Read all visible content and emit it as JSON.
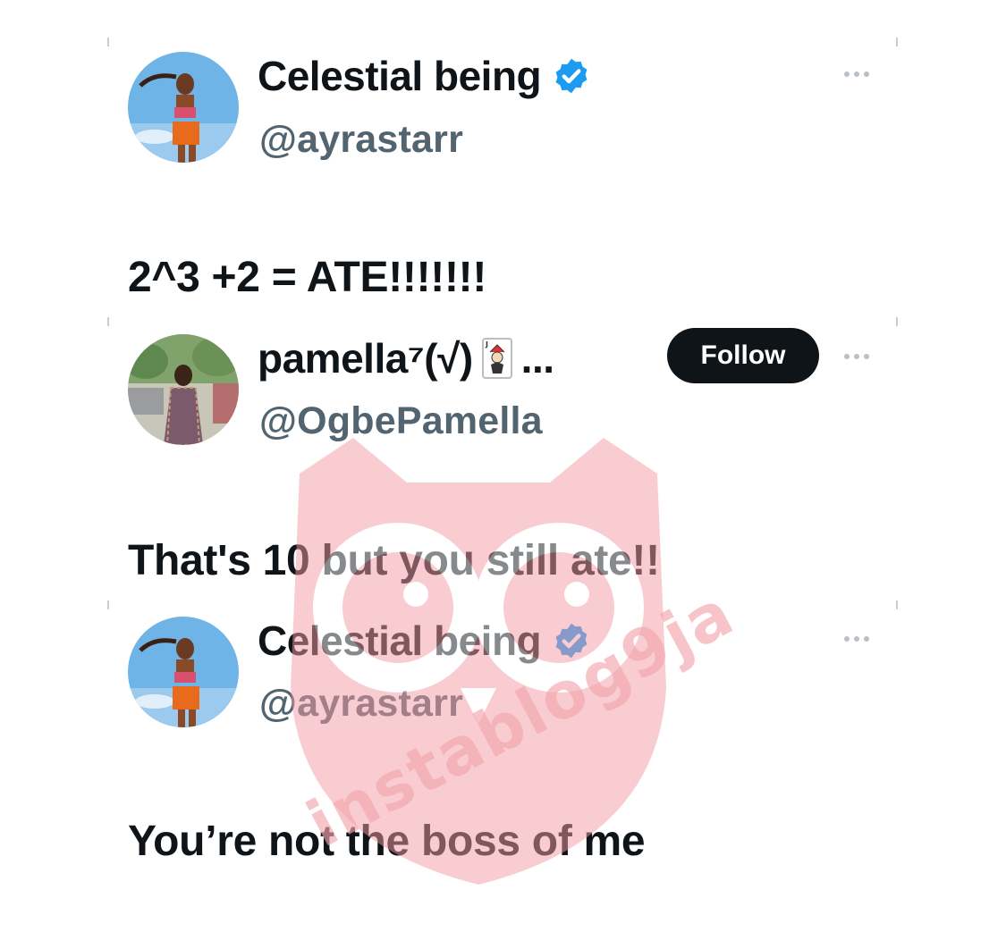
{
  "tweets": [
    {
      "display_name": "Celestial being",
      "verified": true,
      "handle": "@ayrastarr",
      "text": "2^3 +2 = ATE!!!!!!!",
      "avatar_icon": "avatar-photo-woman"
    },
    {
      "display_name": "pamella⁷(√)",
      "name_suffix": "...",
      "name_emoji": "joker-card-icon",
      "handle": "@OgbePamella",
      "follow_label": "Follow",
      "text": "That's 10 but you still ate!!",
      "avatar_icon": "avatar-photo-woman-outdoor"
    },
    {
      "display_name": "Celestial being",
      "verified": true,
      "handle": "@ayrastarr",
      "text": "You’re not the boss of me",
      "avatar_icon": "avatar-photo-woman"
    }
  ],
  "watermark": {
    "text": "instablog9ja",
    "icon": "owl-logo-watermark"
  },
  "colors": {
    "verified_blue": "#1d9bf0",
    "follow_button_bg": "#0f1419",
    "handle_gray": "#536471",
    "watermark_pink": "#f3a6ad"
  }
}
